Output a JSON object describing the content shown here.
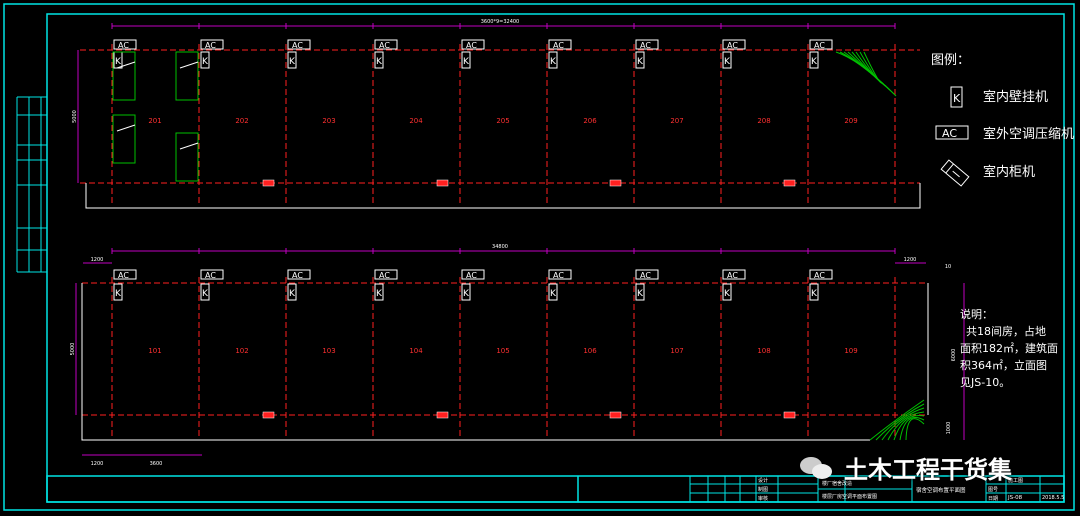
{
  "colors": {
    "frame": "#00e5e5",
    "dim": "#c000c0",
    "axis": "#ff2020",
    "white": "#ffffff",
    "green": "#00c000",
    "text": "#ffffff",
    "room": "#ff3030"
  },
  "legend": {
    "title": "图例：",
    "items": [
      {
        "symbol": "K",
        "label": "室内壁挂机",
        "icon": "wall-unit-icon"
      },
      {
        "symbol": "AC",
        "label": "室外空调压缩机",
        "icon": "outdoor-compressor-icon"
      },
      {
        "symbol": "",
        "label": "室内柜机",
        "icon": "cabinet-unit-icon"
      }
    ]
  },
  "notes": {
    "title": "说明：",
    "lines": [
      "共18间房，占地",
      "面积182㎡，建筑面",
      "积364㎡，立面图",
      "见JS-10。"
    ]
  },
  "upper_plan": {
    "tag": "AC",
    "unit_symbol": "K",
    "rooms": [
      "201",
      "202",
      "203",
      "204",
      "205",
      "206",
      "207",
      "208",
      "209"
    ],
    "dim_top": "3600*9=32400",
    "dim_left": "5000"
  },
  "lower_plan": {
    "tag": "AC",
    "unit_symbol": "K",
    "rooms": [
      "101",
      "102",
      "103",
      "104",
      "105",
      "106",
      "107",
      "108",
      "109"
    ],
    "dim_top": "34800",
    "dim_left_ext": "1200",
    "dim_right_ext": "1200",
    "dim_left": "5000",
    "dim_right": "6000",
    "dim_right_small": "1000",
    "dim_bottom_left": "1200",
    "dim_bottom_bay": "3600",
    "dim_right_top": "10"
  },
  "title_block": {
    "cells": [
      "设计",
      "制图",
      "审核",
      "校对",
      "图号",
      "日期"
    ],
    "project": "楼厂宿舍改造",
    "drawing": "楼层厂房空调平面布置图",
    "title": "宿舍空调布置平面图",
    "sheet": "JS-08",
    "stage": "施工图",
    "date": "2018.5.5"
  },
  "watermark": {
    "text": "土木工程干货集",
    "icon": "wechat-icon"
  }
}
